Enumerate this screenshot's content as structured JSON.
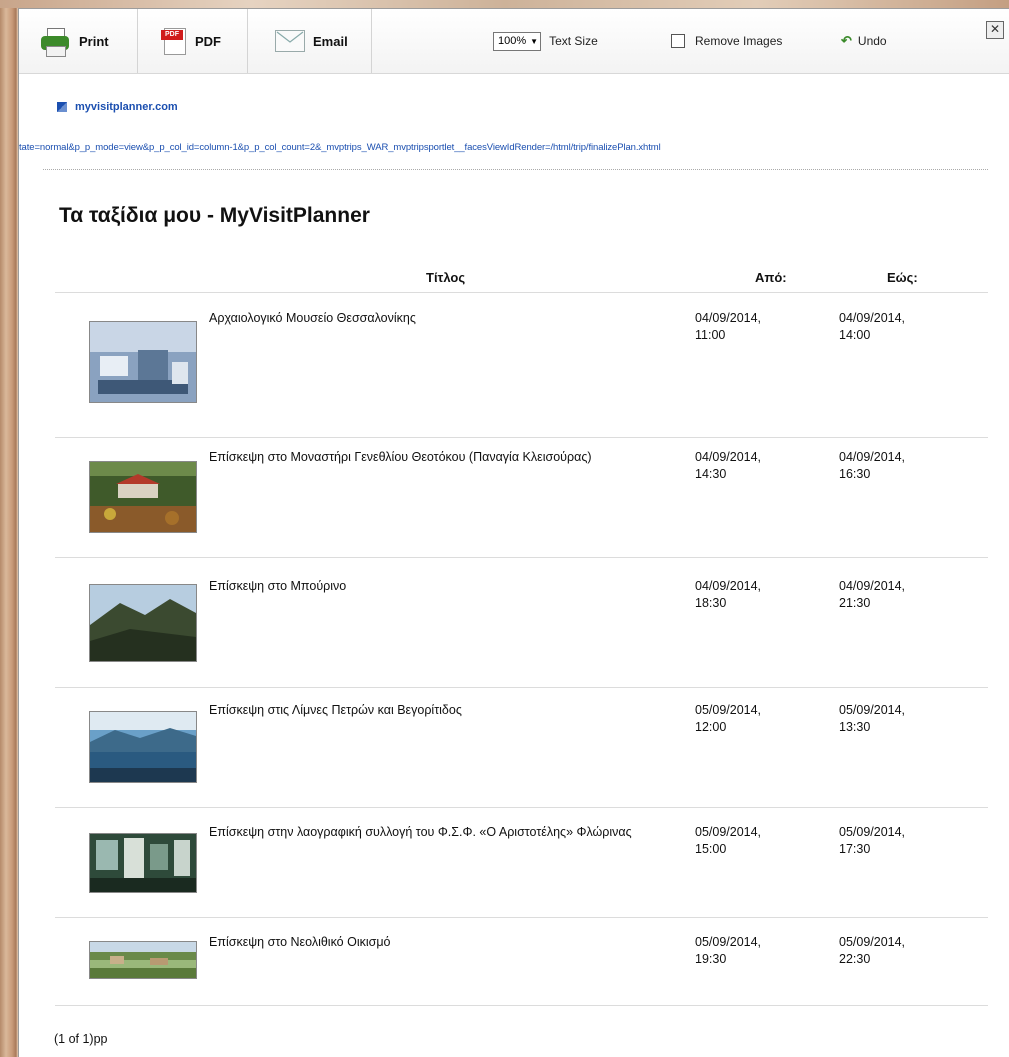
{
  "toolbar": {
    "print_label": "Print",
    "pdf_label": "PDF",
    "pdf_icon_text": "PDF",
    "email_label": "Email",
    "zoom_value": "100%",
    "text_size_label": "Text Size",
    "remove_images_label": "Remove Images",
    "remove_images_checked": false,
    "undo_label": "Undo",
    "close_symbol": "✕"
  },
  "site": {
    "name": "myvisitplanner.com",
    "url": "tate=normal&p_p_mode=view&p_p_col_id=column-1&p_p_col_count=2&_mvptrips_WAR_mvptripsportlet__facesViewIdRender=/html/trip/finalizePlan.xhtml"
  },
  "page": {
    "title": "Τα ταξίδια μου - MyVisitPlanner"
  },
  "table": {
    "headers": {
      "title": "Τίτλος",
      "from": "Από:",
      "to": "Εώς:"
    },
    "rows": [
      {
        "title": "Αρχαιολογικό Μουσείο Θεσσαλονίκης",
        "from_date": "04/09/2014,",
        "from_time": "11:00",
        "to_date": "04/09/2014,",
        "to_time": "14:00",
        "image": "museum-interior"
      },
      {
        "title": "Επίσκεψη στο Μοναστήρι Γενεθλίου Θεοτόκου (Παναγία Κλεισούρας)",
        "from_date": "04/09/2014,",
        "from_time": "14:30",
        "to_date": "04/09/2014,",
        "to_time": "16:30",
        "image": "monastery-village"
      },
      {
        "title": "Επίσκεψη στο Μπούρινο",
        "from_date": "04/09/2014,",
        "from_time": "18:30",
        "to_date": "04/09/2014,",
        "to_time": "21:30",
        "image": "mountain"
      },
      {
        "title": "Επίσκεψη στις Λίμνες Πετρών και Βεγορίτιδος",
        "from_date": "05/09/2014,",
        "from_time": "12:00",
        "to_date": "05/09/2014,",
        "to_time": "13:30",
        "image": "lake"
      },
      {
        "title": "Επίσκεψη στην λαογραφική συλλογή του Φ.Σ.Φ. «Ο Αριστοτέλης» Φλώρινας",
        "from_date": "05/09/2014,",
        "from_time": "15:00",
        "to_date": "05/09/2014,",
        "to_time": "17:30",
        "image": "folk-collection"
      },
      {
        "title": "Επίσκεψη στο Νεολιθικό Οικισμό",
        "from_date": "05/09/2014,",
        "from_time": "19:30",
        "to_date": "05/09/2014,",
        "to_time": "22:30",
        "image": "neolithic-settlement"
      }
    ]
  },
  "pager": {
    "text": "(1 of 1)pp"
  }
}
